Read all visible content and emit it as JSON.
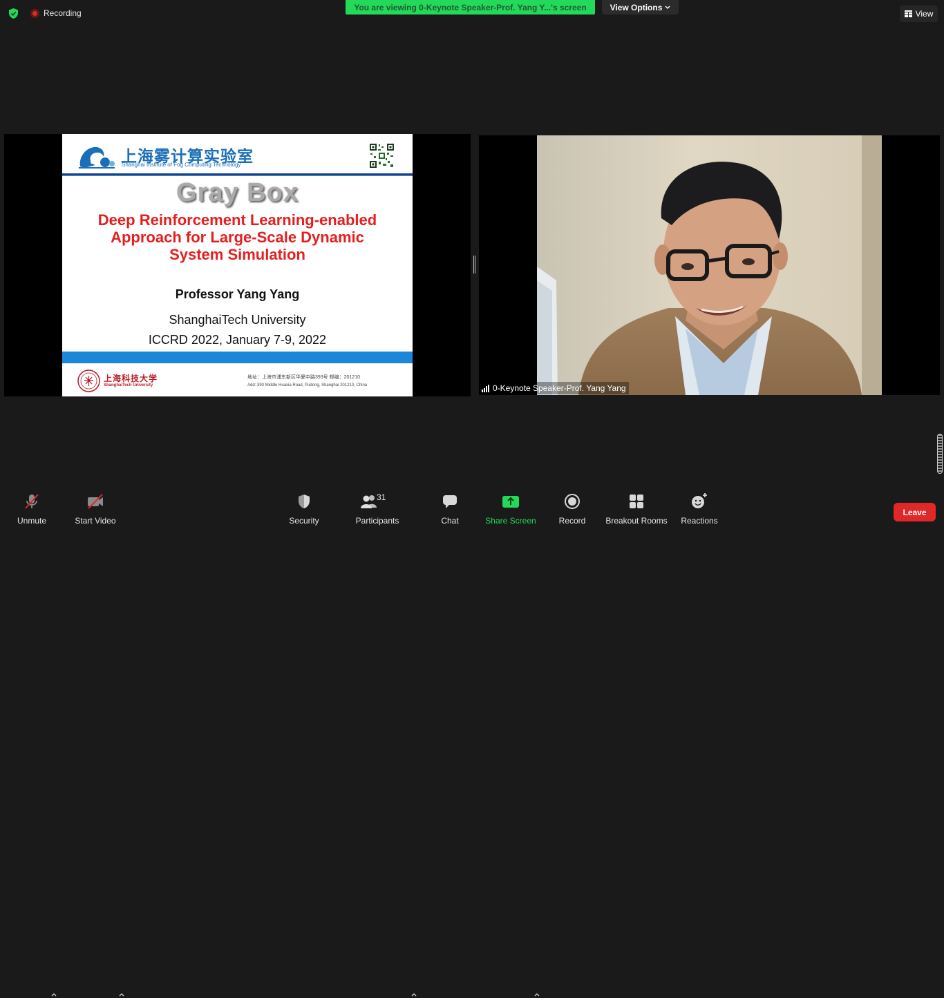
{
  "top_bar": {
    "recording_label": "Recording",
    "viewing_banner": "You are viewing 0-Keynote Speaker-Prof. Yang Y...'s screen",
    "view_options_label": "View Options",
    "view_label": "View"
  },
  "shared_slide": {
    "lab_name_cn": "上海雾计算实验室",
    "lab_name_en": "Shanghai Institute of Fog Computing Technology",
    "headline": "Gray Box",
    "subtitle_line1": "Deep Reinforcement Learning-enabled",
    "subtitle_line2": "Approach for Large-Scale Dynamic",
    "subtitle_line3": "System Simulation",
    "presenter": "Professor Yang Yang",
    "university": "ShanghaiTech University",
    "conference": "ICCRD 2022, January 7-9, 2022",
    "university_cn": "上海科技大学",
    "university_en": "ShanghaiTech University",
    "address_cn": "地址：上海市浦东新区华夏中路393号   邮编：201210",
    "address_en": "Add: 393 Middle Huaxia Road, Pudong, Shanghai 201210, China"
  },
  "speaker": {
    "name": "0-Keynote Speaker-Prof. Yang Yang"
  },
  "toolbar": {
    "unmute": "Unmute",
    "start_video": "Start Video",
    "security": "Security",
    "participants": "Participants",
    "participants_count": "31",
    "chat": "Chat",
    "share_screen": "Share Screen",
    "record": "Record",
    "breakout_rooms": "Breakout Rooms",
    "reactions": "Reactions",
    "leave": "Leave"
  },
  "colors": {
    "background": "#1a1a1a",
    "banner_green": "#23d959",
    "slide_red": "#e61e1e",
    "slide_blue": "#1c86d8",
    "leave_red": "#e02828"
  },
  "icons": [
    "shield-check-icon",
    "recording-dot-icon",
    "chevron-down-icon",
    "grid-view-icon",
    "microphone-muted-icon",
    "video-camera-muted-icon",
    "security-shield-icon",
    "participants-icon",
    "chat-bubble-icon",
    "share-screen-arrow-icon",
    "record-icon",
    "breakout-rooms-icon",
    "reactions-smiley-icon",
    "signal-bars-icon"
  ]
}
